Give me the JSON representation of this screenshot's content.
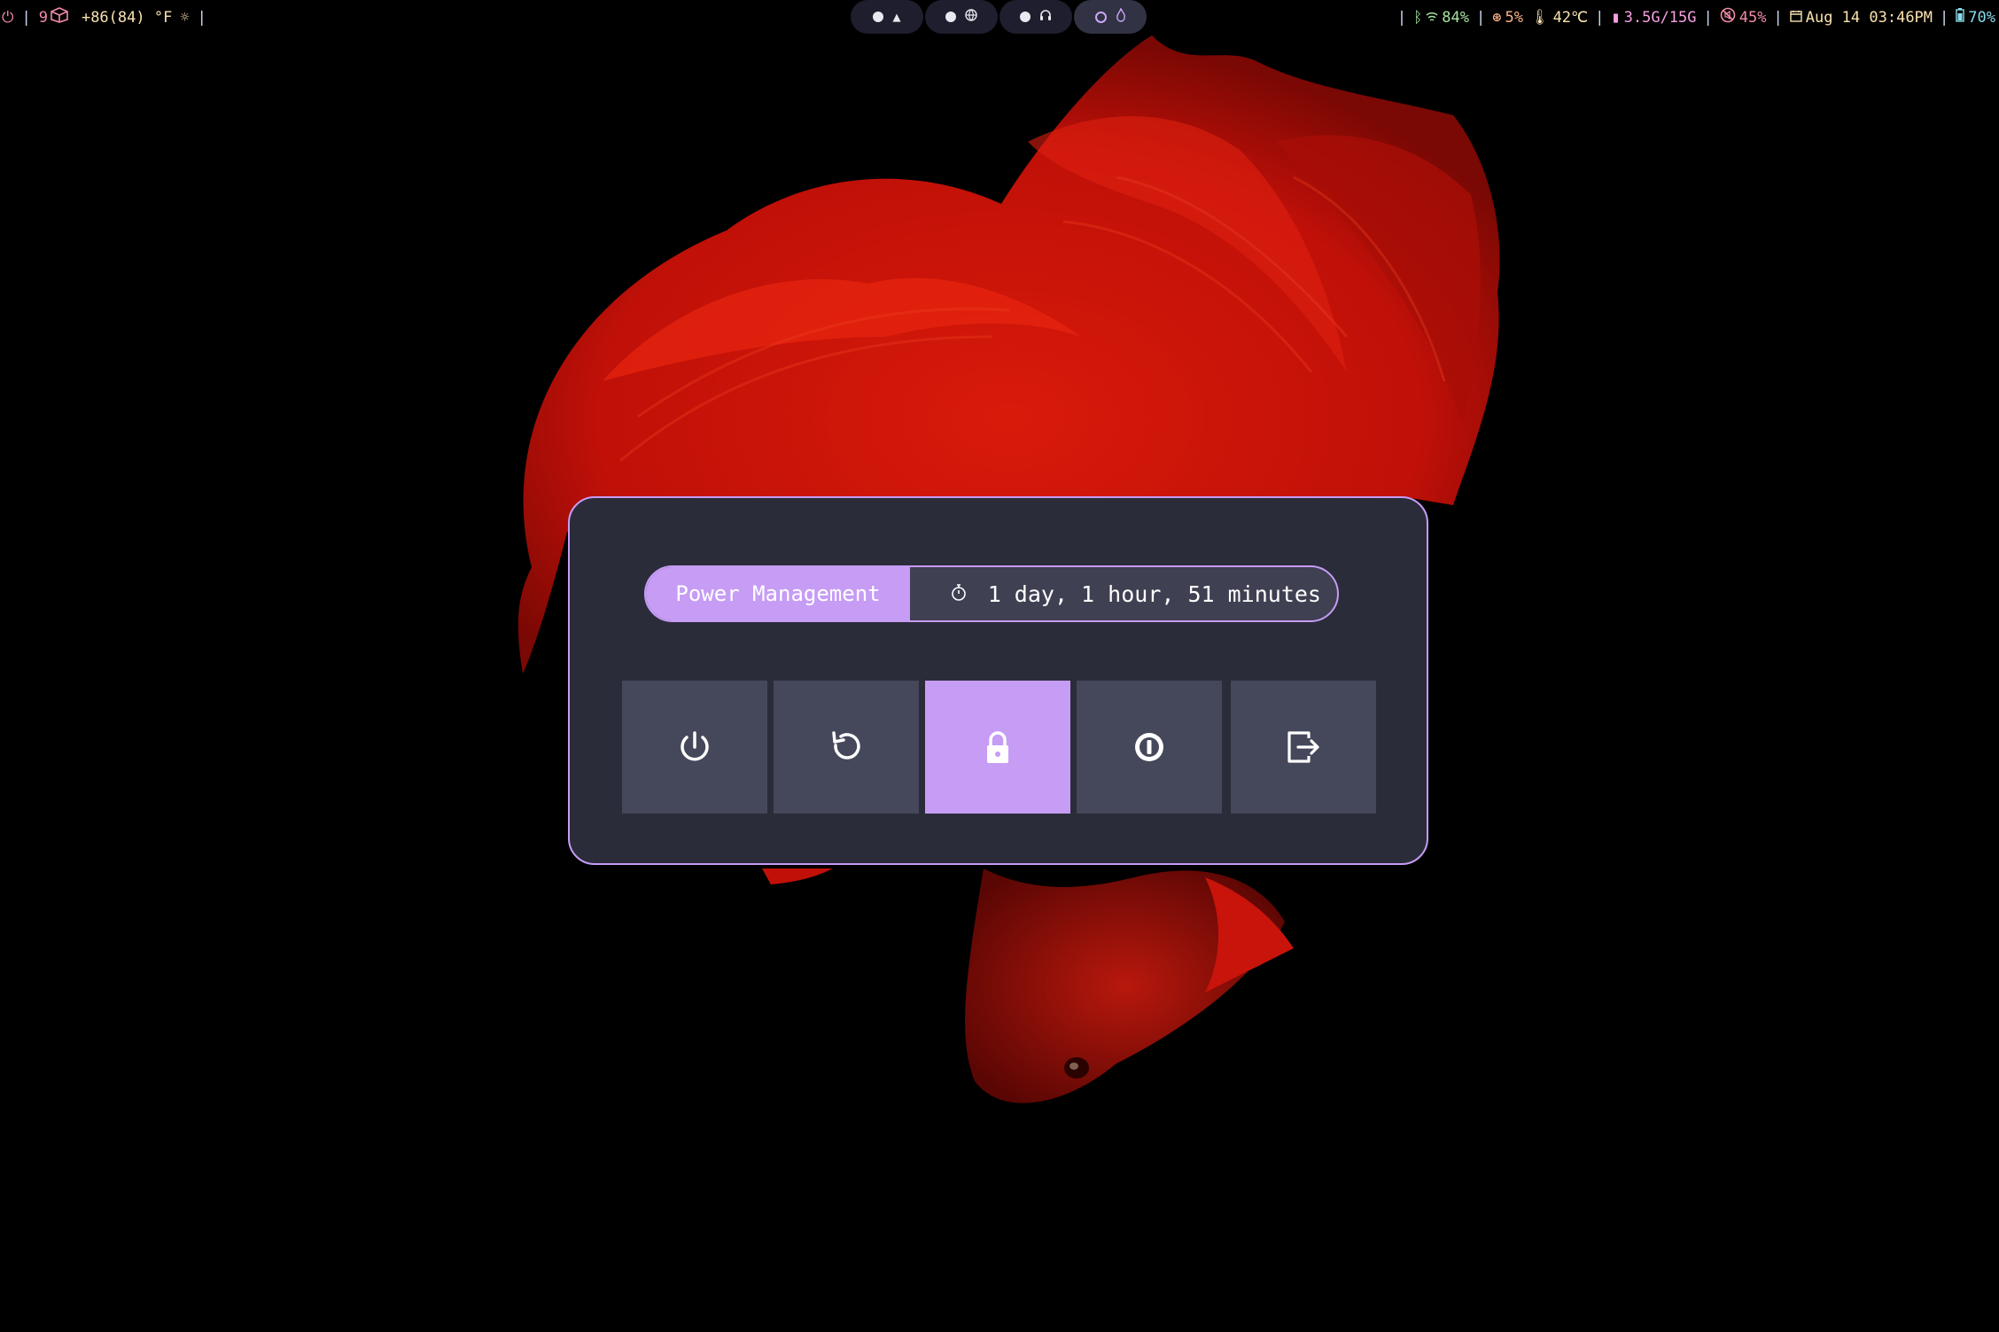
{
  "colors": {
    "accent": "#c69cf5",
    "dialog_bg": "#2b2c3a",
    "button_bg": "#45475a",
    "bar_bg": "#1e1e2e"
  },
  "topbar": {
    "left": {
      "power_icon": "power-icon",
      "workspace_count": "9",
      "package_icon": "package-icon",
      "weather": "+86(84) °F",
      "weather_icon": "sun-icon"
    },
    "workspaces": [
      {
        "icon": "arch-icon",
        "active": false
      },
      {
        "icon": "globe-icon",
        "active": false
      },
      {
        "icon": "headphones-icon",
        "active": false
      },
      {
        "icon": "flame-icon",
        "active": true
      }
    ],
    "right": {
      "bluetooth_icon": "bluetooth-icon",
      "wifi_icon": "wifi-icon",
      "wifi": "84%",
      "cpu_icon": "cpu-icon",
      "cpu": "5%",
      "temp_icon": "thermometer-icon",
      "temp": "42℃",
      "memory_icon": "memory-icon",
      "memory": "3.5G/15G",
      "volume_icon": "muted-icon",
      "volume": "45%",
      "calendar_icon": "calendar-icon",
      "datetime": "Aug 14 03:46PM",
      "battery_icon": "battery-icon",
      "battery": "70%"
    }
  },
  "power_menu": {
    "title": "Power Management",
    "uptime_icon": "stopwatch-icon",
    "uptime": "1 day, 1 hour, 51 minutes",
    "buttons": [
      {
        "icon": "power-icon",
        "action": "shutdown"
      },
      {
        "icon": "reboot-icon",
        "action": "reboot"
      },
      {
        "icon": "lock-icon",
        "action": "lock",
        "selected": true
      },
      {
        "icon": "suspend-icon",
        "action": "suspend"
      },
      {
        "icon": "logout-icon",
        "action": "logout"
      }
    ]
  }
}
